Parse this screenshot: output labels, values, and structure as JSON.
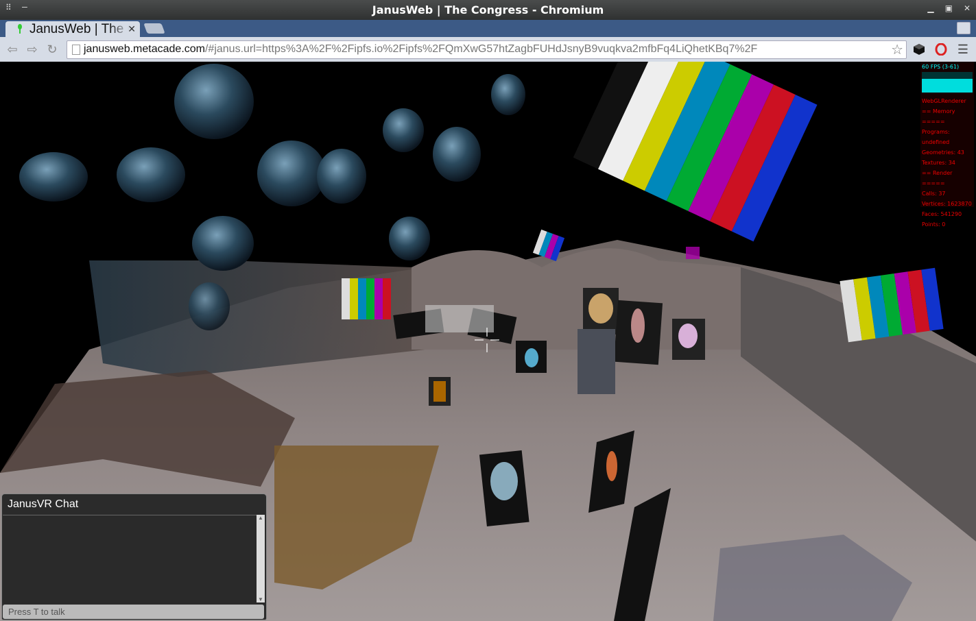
{
  "window": {
    "title": "JanusWeb | The Congress - Chromium"
  },
  "tabs": [
    {
      "label": "JanusWeb | The Congress"
    }
  ],
  "toolbar": {
    "url_host": "janusweb.metacade.com",
    "url_rest": "/#janus.url=https%3A%2F%2Fipfs.io%2Fipfs%2FQmXwG57htZagbFUHdJsnyB9vuqkva2mfbFq4LiQhetKBq7%2F"
  },
  "stats": {
    "fps": "60 FPS (3-61)",
    "lines": [
      "WebGLRenderer",
      "== Memory =====",
      "Programs:",
      "undefined",
      "Geometries: 43",
      "Textures: 34",
      "== Render =====",
      "Calls: 37",
      "Vertices: 1623870",
      "Faces: 541290",
      "Points: 0"
    ]
  },
  "chat": {
    "title": "JanusVR Chat",
    "input_placeholder": "Press T to talk"
  },
  "colors": {
    "tabstrip": "#3c5a86",
    "toolbar": "#d6dce6",
    "stats_fps": "#00ffff",
    "stats_text": "#ee0000"
  },
  "icons": [
    "back-icon",
    "forward-icon",
    "reload-icon",
    "page-icon",
    "star-icon",
    "cube-extension-icon",
    "opera-extension-icon",
    "menu-icon",
    "crosshair-icon"
  ]
}
